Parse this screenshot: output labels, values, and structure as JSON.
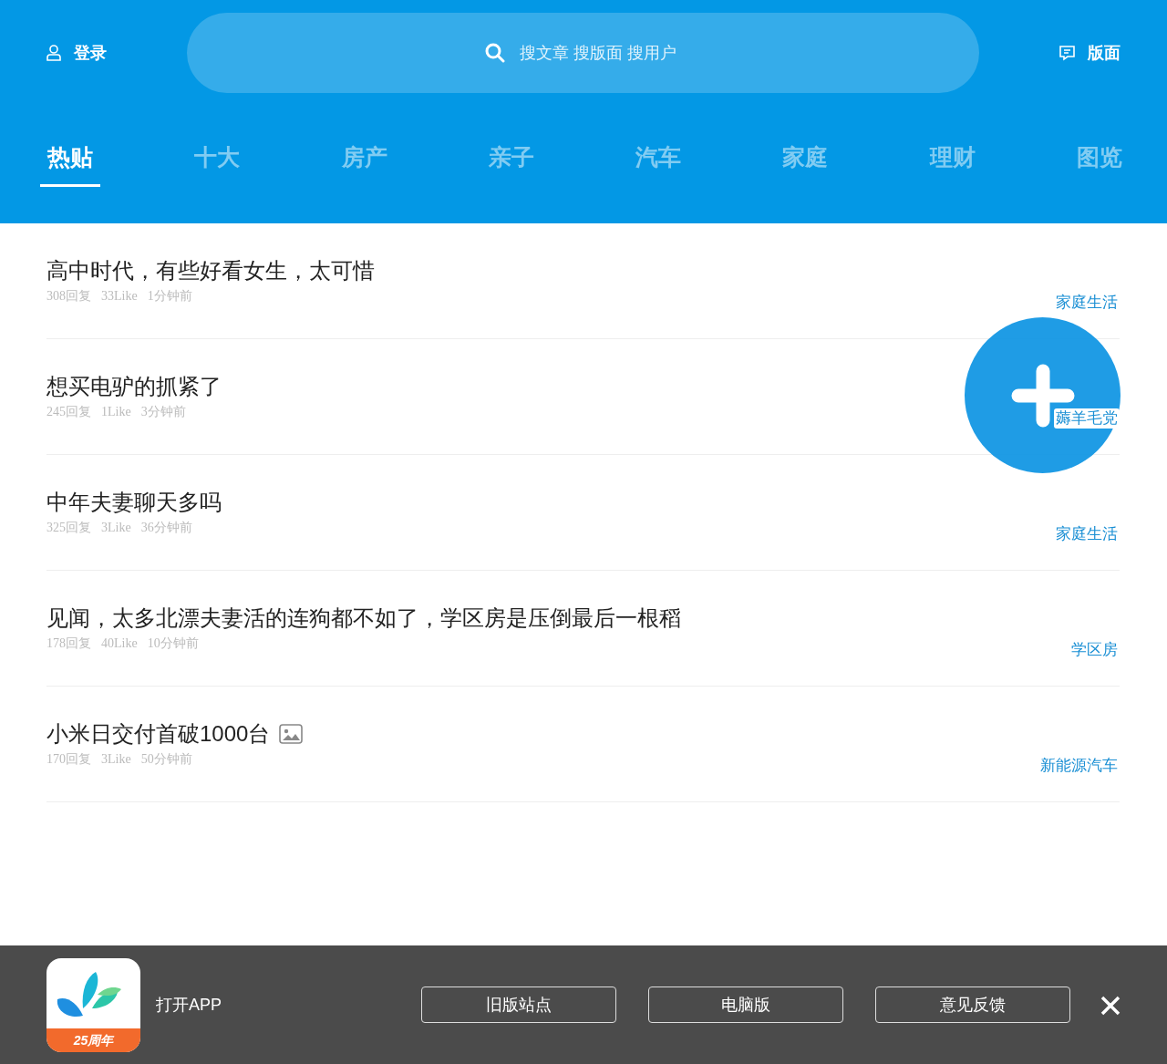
{
  "header": {
    "login_label": "登录",
    "search": {
      "placeholder": "搜文章 搜版面 搜用户"
    },
    "boards_label": "版面"
  },
  "tabs": [
    {
      "label": "热贴",
      "selected": true
    },
    {
      "label": "十大",
      "selected": false
    },
    {
      "label": "房产",
      "selected": false
    },
    {
      "label": "亲子",
      "selected": false
    },
    {
      "label": "汽车",
      "selected": false
    },
    {
      "label": "家庭",
      "selected": false
    },
    {
      "label": "理财",
      "selected": false
    },
    {
      "label": "图览",
      "selected": false
    }
  ],
  "posts": [
    {
      "title": "高中时代，有些好看女生，太可惜",
      "replies": "308回复",
      "likes": "33Like",
      "time": "1分钟前",
      "board": "家庭生活",
      "has_image": false
    },
    {
      "title": "想买电驴的抓紧了",
      "replies": "245回复",
      "likes": "1Like",
      "time": "3分钟前",
      "board": "薅羊毛党",
      "has_image": false
    },
    {
      "title": "中年夫妻聊天多吗",
      "replies": "325回复",
      "likes": "3Like",
      "time": "36分钟前",
      "board": "家庭生活",
      "has_image": false
    },
    {
      "title": "见闻，太多北漂夫妻活的连狗都不如了，学区房是压倒最后一根稻",
      "replies": "178回复",
      "likes": "40Like",
      "time": "10分钟前",
      "board": "学区房",
      "has_image": false
    },
    {
      "title": "小米日交付首破1000台",
      "replies": "170回复",
      "likes": "3Like",
      "time": "50分钟前",
      "board": "新能源汽车",
      "has_image": true
    }
  ],
  "app_bar": {
    "logo_badge": "25周年",
    "open_app": "打开APP",
    "buttons": [
      "旧版站点",
      "电脑版",
      "意见反馈"
    ]
  }
}
